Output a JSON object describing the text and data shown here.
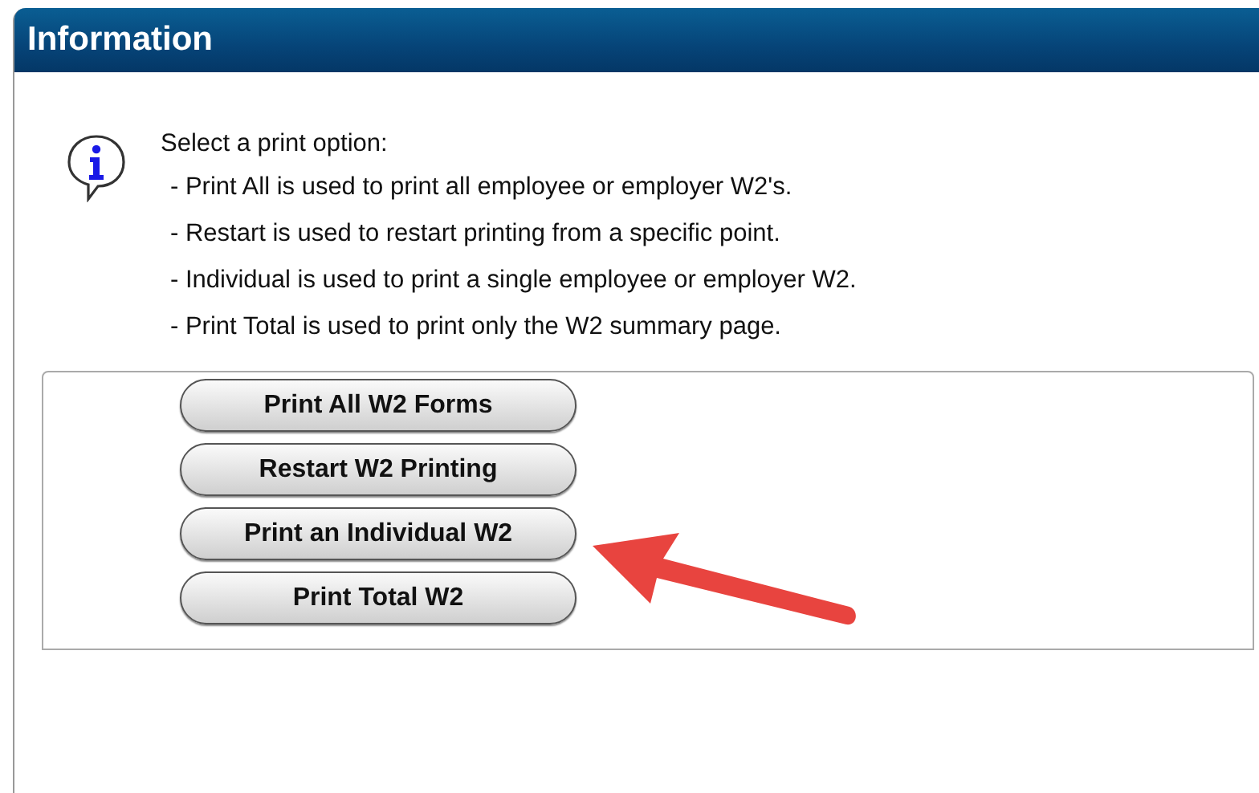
{
  "window": {
    "title": "Information"
  },
  "message": {
    "heading": "Select a print option:",
    "lines": [
      "- Print All is used to print all employee or employer W2's.",
      "- Restart is used to restart printing from a specific point.",
      "- Individual is used to print a single employee or employer W2.",
      "- Print Total is used to print only the W2 summary page."
    ]
  },
  "buttons": [
    {
      "label": "Print All W2 Forms",
      "highlighted": false
    },
    {
      "label": "Restart W2 Printing",
      "highlighted": false
    },
    {
      "label": "Print an Individual W2",
      "highlighted": true
    },
    {
      "label": "Print Total W2",
      "highlighted": false
    }
  ]
}
